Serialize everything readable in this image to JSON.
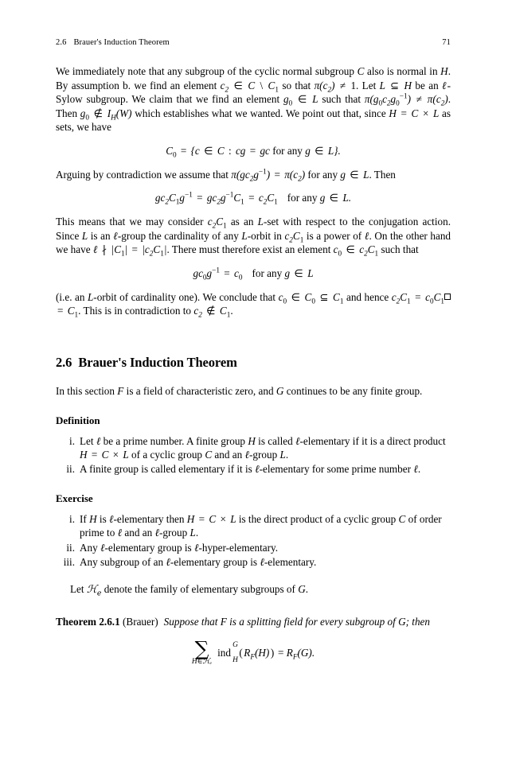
{
  "page": {
    "running_head": {
      "section_number": "2.6",
      "section_title": "Brauer's Induction Theorem",
      "page_number": "71"
    }
  },
  "proof_continuation": {
    "paragraph_1": {
      "l1": "We immediately note that any subgroup of the cyclic normal subgroup ",
      "v1": "C",
      "l2": " also is normal in ",
      "v2": "H",
      "l3": ". By assumption b. we find an element ",
      "v3": "c₂ ∈ C \\ C₁",
      "l4": " so that ",
      "v4": "π(c₂) ≠ 1",
      "l5": ". Let ",
      "v5": "L ⊆ H",
      "l6": " be an ",
      "v6": "ℓ",
      "l7": "-Sylow subgroup. We claim that we find an element ",
      "v7": "g₀ ∈ L",
      "l8": " such that ",
      "v8": "π(g₀c₂g₀⁻¹) ≠ π(c₂)",
      "l9": ". Then ",
      "v9": "g₀ ∉ I_H(W)",
      "l10": " which establishes what we wanted. We point out that, since ",
      "v10": "H = C × L",
      "l11": " as sets, we have"
    },
    "equation_C0": "C₀ = {c ∈ C : cg = gc for any g ∈ L}.",
    "paragraph_2": {
      "l1": "Arguing by contradiction we assume that ",
      "v1": "π(gc₂g⁻¹) = π(c₂)",
      "l2": " for any ",
      "v2": "g ∈ L",
      "l3": ". Then"
    },
    "equation_conj": "gc₂C₁g⁻¹ = gc₂g⁻¹C₁ = c₂C₁    for any g ∈ L.",
    "paragraph_3": {
      "l1": "This means that we may consider ",
      "v1": "c₂C₁",
      "l2": " as an ",
      "v2": "L",
      "l3": "-set with respect to the conjugation action. Since ",
      "v3": "L",
      "l4": " is an ",
      "v4": "ℓ",
      "l5": "-group the cardinality of any ",
      "v5": "L",
      "l6": "-orbit in ",
      "v6": "c₂C₁",
      "l7": " is a power of ",
      "v7": "ℓ",
      "l8": ". On the other hand we have ",
      "v8": "ℓ ∤ |C₁| = |c₂C₁|",
      "l9": ". There must therefore exist an element ",
      "v9": "c₀ ∈ c₂C₁",
      "l10": " such that"
    },
    "equation_fixed": "gc₀g⁻¹ = c₀    for any g ∈ L",
    "paragraph_4": {
      "l1": "(i.e. an ",
      "v1": "L",
      "l2": "-orbit of cardinality one). We conclude that ",
      "v2": "c₀ ∈ C₀ ⊆ C₁",
      "l3": " and hence ",
      "v3": "c₂C₁ = c₀C₁ = C₁",
      "l4": ". This is in contradiction to ",
      "v4": "c₂ ∉ C₁",
      "l5": "."
    },
    "qed_symbol": "□"
  },
  "section": {
    "number": "2.6",
    "title": "Brauer's Induction Theorem",
    "intro": {
      "l1": "In this section ",
      "v1": "F",
      "l2": " is a field of characteristic zero, and ",
      "v2": "G",
      "l3": " continues to be any finite group."
    }
  },
  "definition": {
    "heading": "Definition",
    "items": [
      {
        "marker": "i.",
        "l1": "Let ",
        "v1": "ℓ",
        "l2": " be a prime number. A finite group ",
        "v2": "H",
        "l3": " is called ",
        "v3": "ℓ",
        "l4": "-elementary if it is a direct product ",
        "v4": "H = C × L",
        "l5": " of a cyclic group ",
        "v5": "C",
        "l6": " and an ",
        "v6": "ℓ",
        "l7": "-group ",
        "v7": "L",
        "l8": "."
      },
      {
        "marker": "ii.",
        "l1": "A finite group is called elementary if it is ",
        "v1": "ℓ",
        "l2": "-elementary for some prime number ",
        "v2": "ℓ",
        "l3": "."
      }
    ]
  },
  "exercise": {
    "heading": "Exercise",
    "items": [
      {
        "marker": "i.",
        "l1": "If ",
        "v1": "H",
        "l2": " is ",
        "v2": "ℓ",
        "l3": "-elementary then ",
        "v3": "H = C × L",
        "l4": " is the direct product of a cyclic group ",
        "v4": "C",
        "l5": " of order prime to ",
        "v5": "ℓ",
        "l6": " and an ",
        "v6": "ℓ",
        "l7": "-group ",
        "v7": "L",
        "l8": "."
      },
      {
        "marker": "ii.",
        "l1": "Any ",
        "v1": "ℓ",
        "l2": "-elementary group is ",
        "v2": "ℓ",
        "l3": "-hyper-elementary."
      },
      {
        "marker": "iii.",
        "l1": "Any subgroup of an ",
        "v1": "ℓ",
        "l2": "-elementary group is ",
        "v2": "ℓ",
        "l3": "-elementary."
      }
    ]
  },
  "family_note": {
    "l1": "Let ",
    "v1": "ℋₑ",
    "l2": " denote the family of elementary subgroups of ",
    "v2": "G",
    "l3": "."
  },
  "theorem": {
    "name": "Theorem 2.6.1",
    "attribution": "(Brauer)",
    "statement_1": "Suppose that ",
    "statement_var_F": "F",
    "statement_2": " is a splitting field for every subgroup of ",
    "statement_var_G": "G",
    "statement_3": "; then",
    "formula": {
      "sigma": "∑",
      "limit": "H∈ℋₑ",
      "ind": "ind",
      "ind_sup": "G",
      "ind_sub": "H",
      "argument": "(R_F(H))",
      "equals": " = ",
      "rhs": "R_F(G)."
    }
  }
}
